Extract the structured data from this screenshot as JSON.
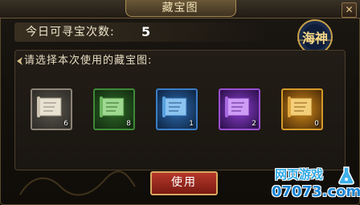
{
  "window": {
    "title": "藏宝图",
    "close_glyph": "✕"
  },
  "header": {
    "count_label": "今日可寻宝次数:",
    "count_value": "5",
    "logo_text": "海神"
  },
  "panel": {
    "prompt": "请选择本次使用的藏宝图:",
    "maps": [
      {
        "quality": "white",
        "count": "6",
        "color": "#8c8478"
      },
      {
        "quality": "green",
        "count": "8",
        "color": "#3f8a38"
      },
      {
        "quality": "blue",
        "count": "1",
        "color": "#3b7ec8"
      },
      {
        "quality": "purple",
        "count": "2",
        "color": "#9a4fd0"
      },
      {
        "quality": "orange",
        "count": "0",
        "color": "#d49a2a"
      }
    ]
  },
  "actions": {
    "use_label": "使用"
  },
  "watermark": {
    "line1": "网页游戏",
    "line2": "07073.com"
  },
  "colors": {
    "accent_gold": "#d9a860",
    "button_red": "#b5382a"
  }
}
